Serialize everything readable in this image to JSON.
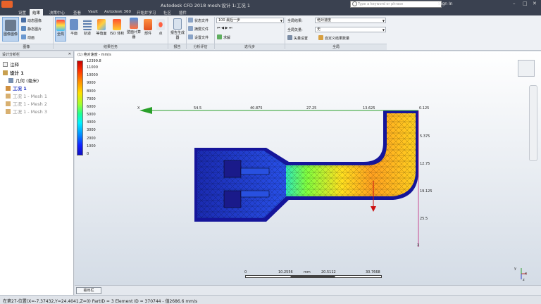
{
  "title": "Autodesk CFD 2018  mesh:设计 1:工况 1",
  "search": {
    "placeholder": "Type a keyword or phrase"
  },
  "signin": "Sign In",
  "tabs": [
    "设置",
    "结果",
    "决策中心",
    "查看",
    "Vault",
    "Autodesk 360",
    "开始并学习",
    "社区",
    "插件"
  ],
  "ribbon": {
    "image_group": {
      "label": "图像",
      "btn_image": "图像图像",
      "dyn_image": "动态图像",
      "static_image": "静态图片",
      "animation": "动画"
    },
    "result_tasks": {
      "label": "结果任务",
      "buttons": [
        "全局",
        "平面",
        "轨迹",
        "等值面",
        "ISO 体积",
        "壁面计算器",
        "部件",
        "点"
      ]
    },
    "report": {
      "label": "报告",
      "gen": "报告生成器"
    },
    "analysis": {
      "label": "分析评估",
      "items": [
        "状态文件",
        "摘要文件",
        "设置文件"
      ]
    },
    "iteration": {
      "label": "迭代步",
      "combo": "100 最后一步",
      "solve": "求解"
    },
    "global": {
      "label": "全局",
      "result_label": "全局结果:",
      "result_value": "绝对速度",
      "vector_label": "全局矢量:",
      "vector_value": "无",
      "vector_settings": "矢量设置",
      "custom": "自定义结果数量"
    }
  },
  "leftpanel": {
    "header": "设计分析栏",
    "items": [
      "注释",
      "设计 1",
      "几何 (毫米)",
      "工况 1",
      "工况 1 - Mesh 1",
      "工况 1 - Mesh 2",
      "工况 1 - Mesh 3"
    ]
  },
  "viewport": {
    "title": "(1) 绝对速度 - mm/s",
    "legend_max": "12399.8",
    "legend_ticks": [
      "11000",
      "10000",
      "9000",
      "8000",
      "7000",
      "6000",
      "5000",
      "4000",
      "3000",
      "2000",
      "1000",
      "0"
    ],
    "x_axis_labels": [
      "X",
      "54.5",
      "40.875",
      "27.25",
      "13.625",
      "0.125"
    ],
    "y_axis_labels": [
      "5.375",
      "12.75",
      "19.125",
      "25.5",
      "X"
    ],
    "scale": {
      "v0": "0",
      "v1": "10.2556",
      "unit": "mm",
      "v2": "20.5112",
      "v3": "30.7668"
    },
    "axis_x": "x",
    "axis_y": "y",
    "axis_z": "z"
  },
  "output_button": "输出栏",
  "status": "在第27-位置(X=-7.37432,Y=24.4041,Z=0) PartID = 3 Element ID = 370744 - 值2686.6  mm/s"
}
